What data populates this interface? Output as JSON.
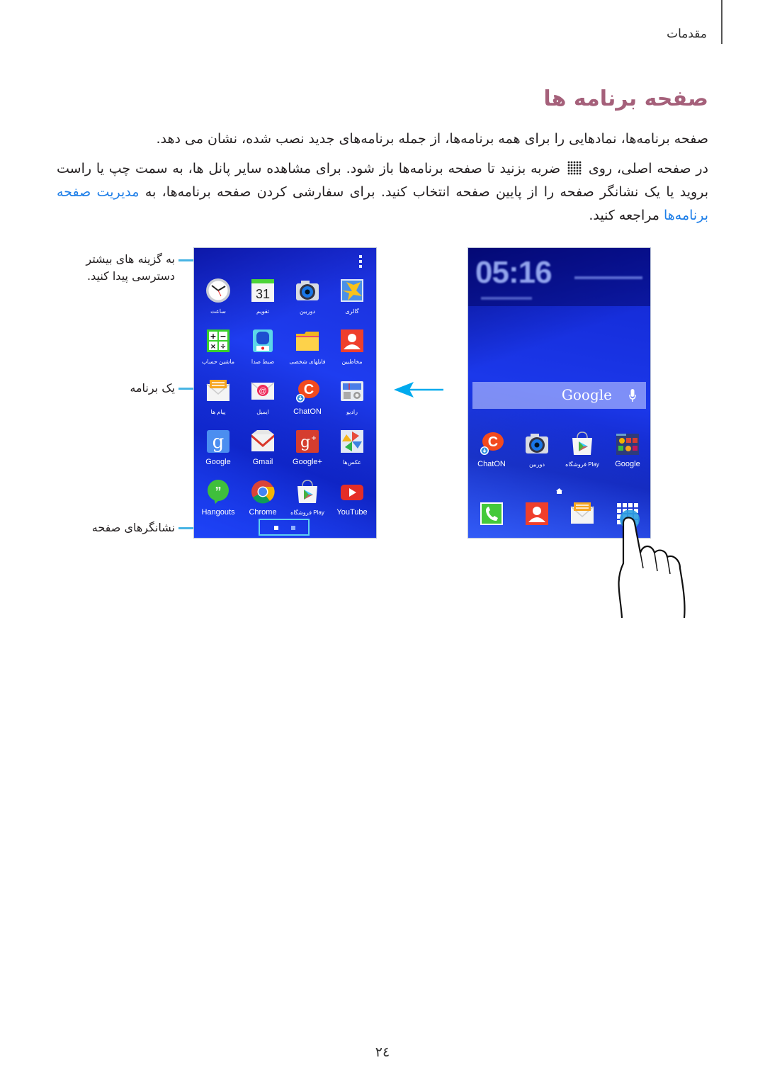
{
  "header": {
    "section": "مقدمات"
  },
  "title": "صفحه برنامه ها",
  "paragraphs": {
    "p1": "صفحه برنامه‌ها، نمادهایی را برای همه برنامه‌ها، از جمله برنامه‌های جدید نصب شده، نشان می دهد.",
    "p2_part1": "در صفحه اصلی، روی",
    "p2_icon": "apps-grid-icon",
    "p2_part2": "ضربه بزنید تا صفحه برنامه‌ها باز شود. برای مشاهده سایر پانل ها، به سمت چپ یا راست بروید یا یک نشانگر صفحه را از پایین صفحه انتخاب کنید. برای سفارشی کردن صفحه برنامه‌ها، به",
    "p2_link": "مدیریت صفحه برنامه‌ها",
    "p2_part3": "مراجعه کنید."
  },
  "callouts": {
    "more_options": "به گزینه های بیشتر دسترسی پیدا کنید.",
    "an_app": "یک برنامه",
    "page_indicators": "نشانگرهای صفحه"
  },
  "apps_screen": {
    "rows": [
      [
        {
          "label": "ساعت",
          "icon": "clock-icon"
        },
        {
          "label": "تقویم",
          "icon": "calendar-icon",
          "value": "31"
        },
        {
          "label": "دوربین",
          "icon": "camera-icon"
        },
        {
          "label": "گالری",
          "icon": "gallery-icon"
        }
      ],
      [
        {
          "label": "ماشین حساب",
          "icon": "calculator-icon"
        },
        {
          "label": "ضبط صدا",
          "icon": "voice-recorder-icon"
        },
        {
          "label": "فایلهای شخصی",
          "icon": "folder-icon"
        },
        {
          "label": "مخاطبین",
          "icon": "contacts-icon"
        }
      ],
      [
        {
          "label": "پیام ها",
          "icon": "messages-icon"
        },
        {
          "label": "ایمیل",
          "icon": "email-icon"
        },
        {
          "label": "ChatON",
          "icon": "chaton-icon"
        },
        {
          "label": "رادیو",
          "icon": "radio-icon"
        }
      ],
      [
        {
          "label": "Google",
          "icon": "google-icon"
        },
        {
          "label": "Gmail",
          "icon": "gmail-icon"
        },
        {
          "label": "Google+",
          "icon": "google-plus-icon"
        },
        {
          "label": "عکس‌ها",
          "icon": "photos-icon"
        }
      ],
      [
        {
          "label": "Hangouts",
          "icon": "hangouts-icon"
        },
        {
          "label": "Chrome",
          "icon": "chrome-icon"
        },
        {
          "label": "فروشگاه Play",
          "icon": "play-store-icon"
        },
        {
          "label": "YouTube",
          "icon": "youtube-icon"
        }
      ]
    ],
    "pages": 2,
    "current_page": 1
  },
  "home_screen": {
    "clock": "05:16",
    "search_brand": "Google",
    "apps": [
      {
        "label": "ChatON",
        "icon": "chaton-icon"
      },
      {
        "label": "دوربین",
        "icon": "camera-icon"
      },
      {
        "label": "فروشگاه Play",
        "icon": "play-store-icon"
      },
      {
        "label": "Google",
        "icon": "google-folder-icon"
      }
    ],
    "dock": [
      {
        "icon": "phone-icon"
      },
      {
        "icon": "contacts-icon"
      },
      {
        "icon": "messages-icon"
      },
      {
        "icon": "apps-grid-icon"
      }
    ]
  },
  "colors": {
    "title": "#a5607a",
    "link": "#1f7fe8",
    "callout_line": "#47b4e4",
    "arrow": "#00aaee"
  },
  "page_number": "۲٤"
}
